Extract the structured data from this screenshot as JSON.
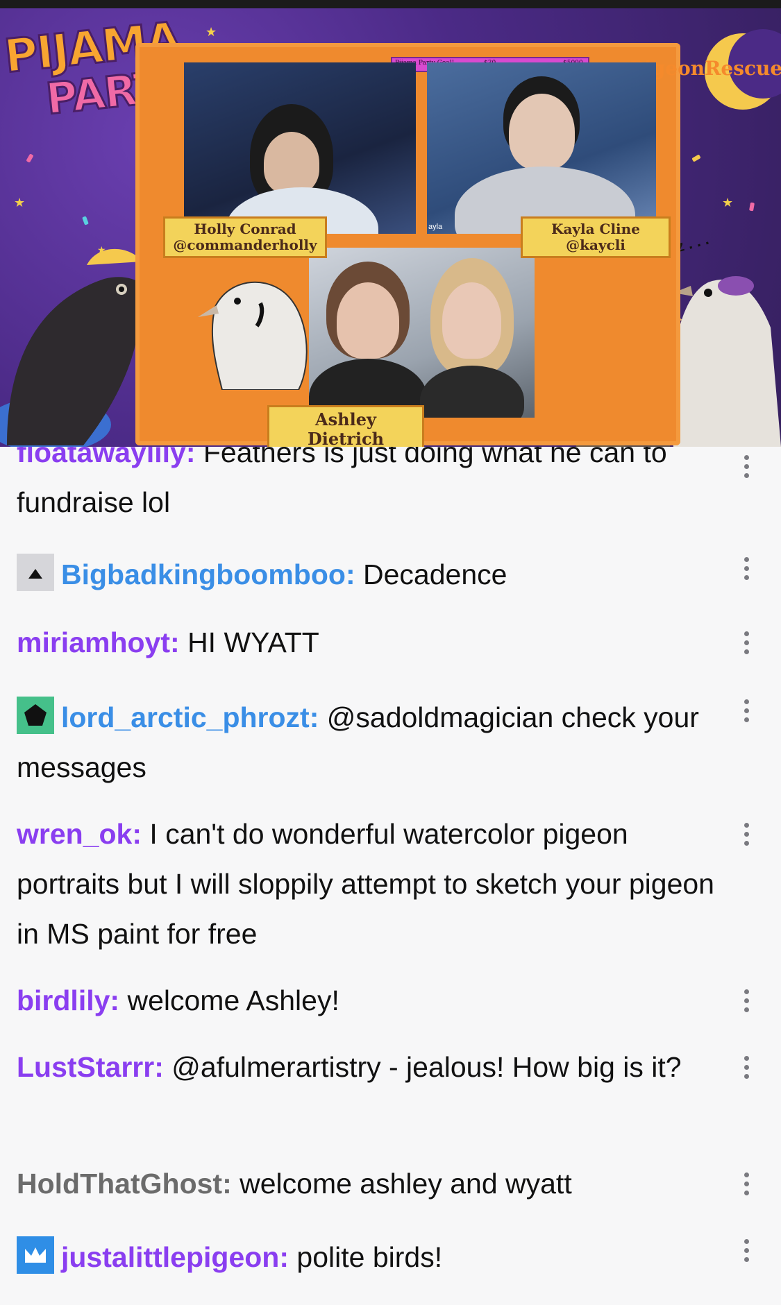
{
  "stream": {
    "logo_line1": "PIJAMA",
    "logo_line2": "PARTY!",
    "goal_label": "Pijama Party Goal!",
    "goal_current": "$30",
    "goal_target": "$5000",
    "site": "PigeonRescue.org",
    "panels": [
      {
        "name": "Holly Conrad",
        "handle": "@commanderholly"
      },
      {
        "name": "Kayla Cline",
        "handle": "@kaycli"
      },
      {
        "name": "Ashley Dietrich"
      }
    ],
    "cam_tag": "ayla",
    "sleep_text": "z z z . . ."
  },
  "chat": {
    "messages": [
      {
        "user": "floatawaylily",
        "text": "Feathers is just doing what he can to fundraise lol",
        "color": "#8a3ef0",
        "badge": null
      },
      {
        "user": "Bigbadkingboomboo",
        "text": "Decadence",
        "color": "#3a8ee6",
        "badge": "arrow-up-icon"
      },
      {
        "user": "miriamhoyt",
        "text": "HI WYATT",
        "color": "#8a3ef0",
        "badge": null
      },
      {
        "user": "lord_arctic_phrozt",
        "text": "@sadoldmagician check your messages",
        "color": "#3a8ee6",
        "badge": "pentagon-icon"
      },
      {
        "user": "wren_ok",
        "text": "I can't do wonderful watercolor pigeon portraits but I will sloppily attempt to sketch your pigeon in MS paint for free",
        "color": "#8a3ef0",
        "badge": null
      },
      {
        "user": "birdlily",
        "text": "welcome Ashley!",
        "color": "#8a3ef0",
        "badge": null
      },
      {
        "user": "LustStarrr",
        "text": "@afulmerartistry - jealous! How big is it?",
        "color": "#8a3ef0",
        "badge": null
      },
      {
        "user": "HoldThatGhost",
        "text": "welcome ashley and wyatt",
        "color": "#6b6b6b",
        "badge": null
      },
      {
        "user": "justalittlepigeon",
        "text": "polite birds!",
        "color": "#8a3ef0",
        "badge": "crown-icon"
      }
    ]
  }
}
